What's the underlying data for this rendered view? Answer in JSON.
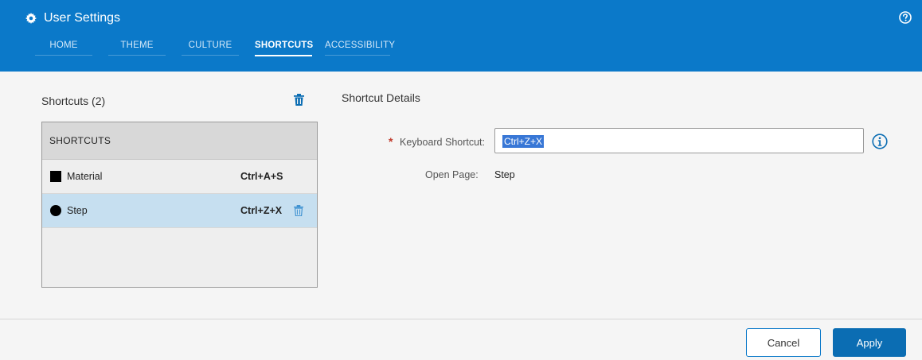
{
  "window": {
    "title": "User Settings",
    "title_icon": "gear-icon",
    "help_icon": "help-circle-icon"
  },
  "tabs": [
    {
      "label": "HOME",
      "active": false
    },
    {
      "label": "THEME",
      "active": false
    },
    {
      "label": "CULTURE",
      "active": false
    },
    {
      "label": "SHORTCUTS",
      "active": true
    },
    {
      "label": "ACCESSIBILITY",
      "active": false
    }
  ],
  "shortcuts_panel": {
    "title": "Shortcuts (2)",
    "delete_icon": "trash-icon",
    "list_header": "SHORTCUTS",
    "items": [
      {
        "name": "Material",
        "keys": "Ctrl+A+S",
        "shape": "square",
        "selected": false
      },
      {
        "name": "Step",
        "keys": "Ctrl+Z+X",
        "shape": "circle",
        "selected": true
      }
    ]
  },
  "details": {
    "title": "Shortcut Details",
    "required_marker": "*",
    "keyboard_label": "Keyboard Shortcut:",
    "keyboard_value": "Ctrl+Z+X",
    "info_icon": "info-icon",
    "open_page_label": "Open Page:",
    "open_page_value": "Step"
  },
  "footer": {
    "cancel_label": "Cancel",
    "apply_label": "Apply"
  },
  "colors": {
    "header_bg": "#0b79c9",
    "selected_row": "#c6dff0",
    "apply_bg": "#0b6db3",
    "required": "#c0392b",
    "selection_highlight": "#3877d6"
  }
}
